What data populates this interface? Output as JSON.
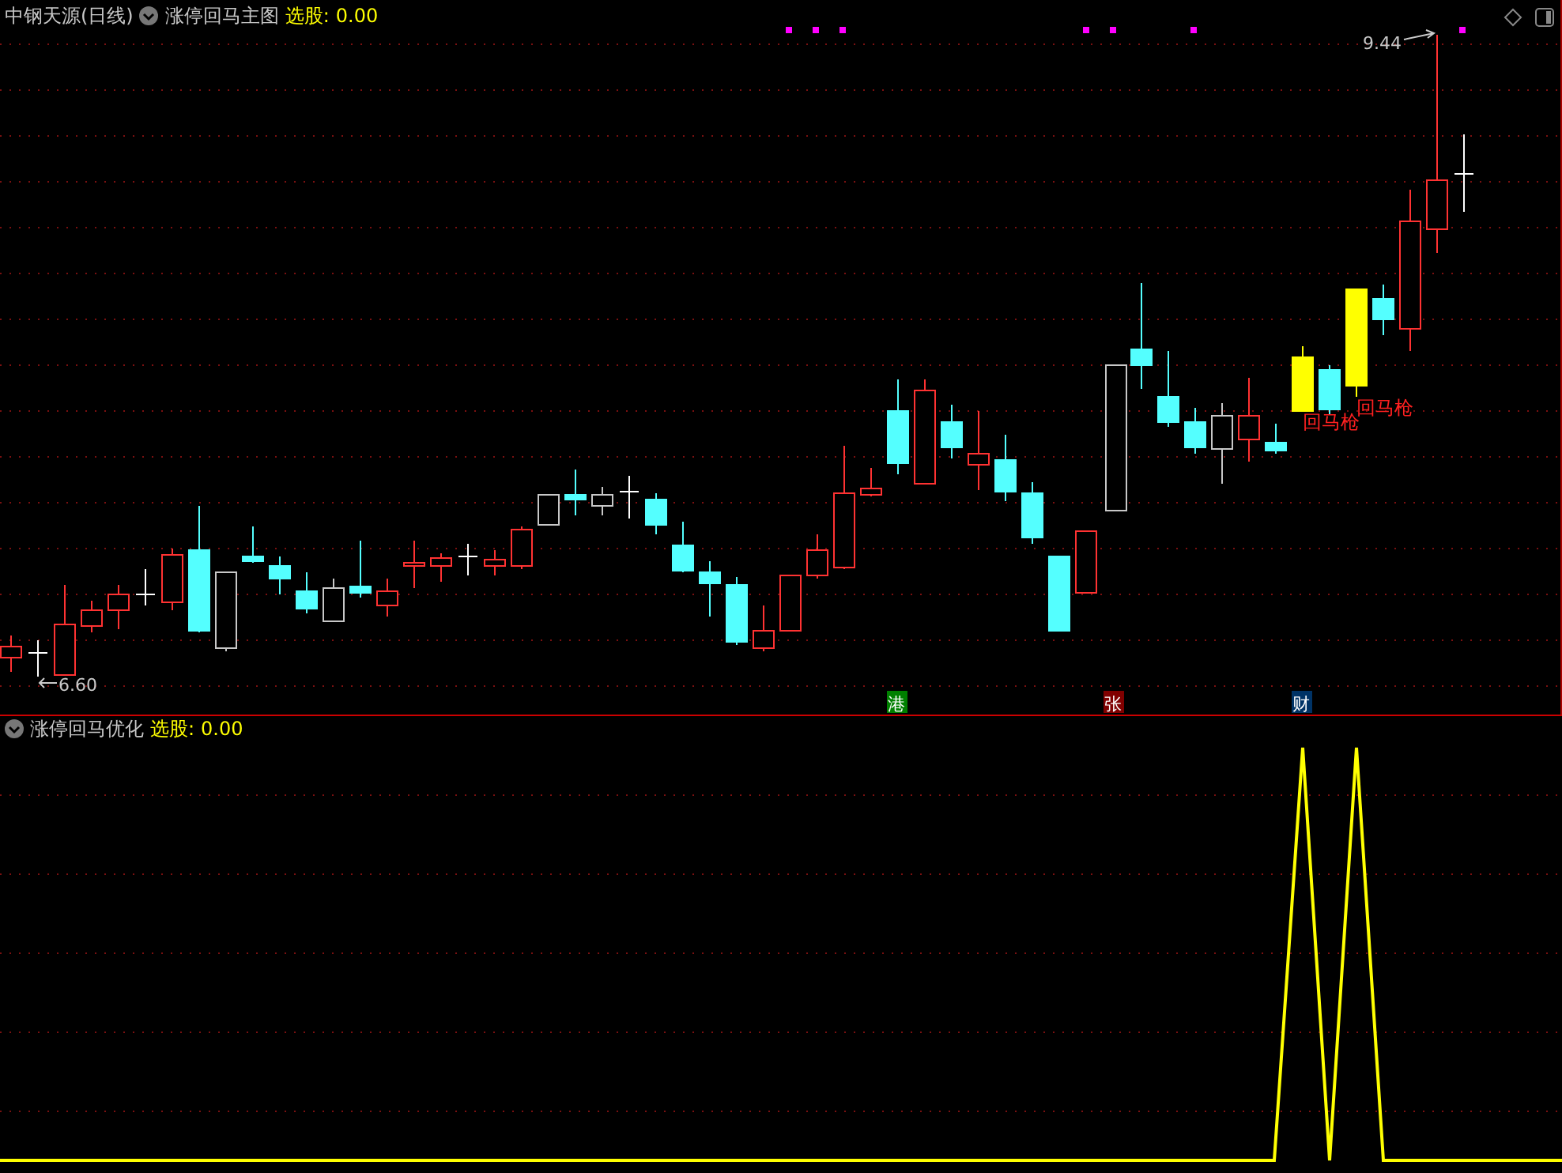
{
  "main_panel": {
    "stock_title": "中钢天源(日线)",
    "indicator": "涨停回马主图",
    "select_label": "选股:",
    "select_value": "0.00",
    "high_label": "9.44",
    "low_label": "6.60",
    "signal_labels": [
      "回马枪",
      "回马枪"
    ],
    "markers": [
      {
        "label": "港",
        "color": "#008000"
      },
      {
        "label": "张",
        "color": "#800000"
      },
      {
        "label": "财",
        "color": "#003366"
      }
    ]
  },
  "sub_panel": {
    "indicator": "涨停回马优化",
    "select_label": "选股:",
    "select_value": "0.00"
  }
}
